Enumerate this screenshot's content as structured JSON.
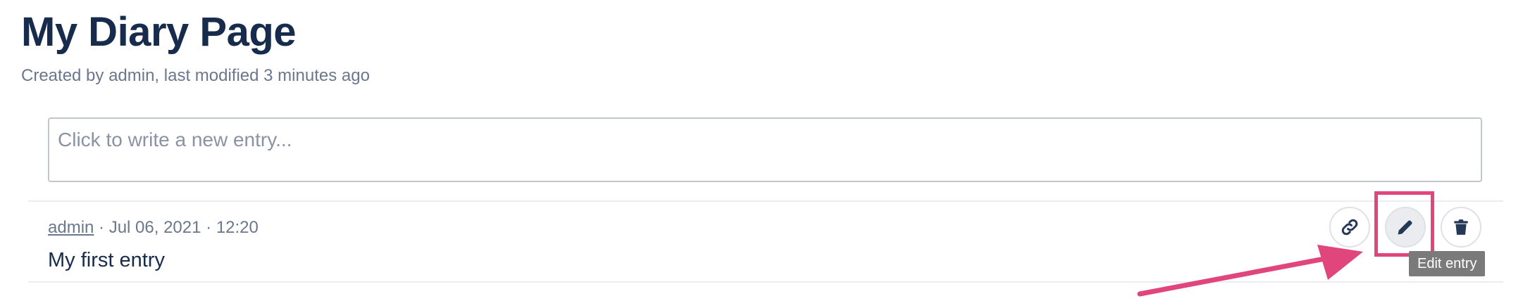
{
  "page": {
    "title": "My Diary Page",
    "meta": "Created by admin, last modified 3 minutes ago"
  },
  "editor": {
    "placeholder": "Click to write a new entry..."
  },
  "entry": {
    "author": "admin",
    "separator1": " · ",
    "date": "Jul 06, 2021",
    "separator2": " · ",
    "time": "12:20",
    "text": "My first entry"
  },
  "actions": {
    "link_icon": "link-icon",
    "edit_icon": "pencil-icon",
    "delete_icon": "trash-icon",
    "tooltip": "Edit entry"
  },
  "colors": {
    "title": "#172b4d",
    "meta": "#6b778c",
    "highlight": "#e0457b",
    "tooltip_bg": "#7a7a7a"
  }
}
